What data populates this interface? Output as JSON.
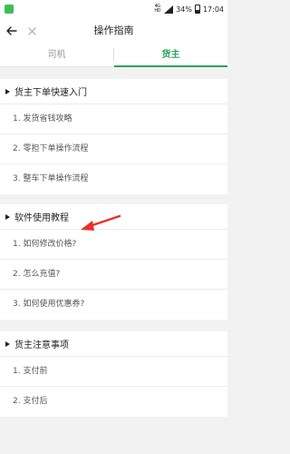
{
  "status_bar": {
    "network_top": "4G",
    "network_bottom": "HD",
    "battery": "34%",
    "time": "17:04",
    "app_icon_color": "#3fbf57"
  },
  "nav": {
    "title": "操作指南",
    "back_icon": "arrow-left-icon",
    "close_icon": "close-icon"
  },
  "tabs": [
    {
      "label": "司机",
      "active": false
    },
    {
      "label": "货主",
      "active": true
    }
  ],
  "accent_color": "#2aa35e",
  "annotation_color": "#e8312a",
  "sections": [
    {
      "title": "货主下单快速入门",
      "items": [
        "1. 发货省钱攻略",
        "2. 零担下单操作流程",
        "3. 整车下单操作流程"
      ]
    },
    {
      "title": "软件使用教程",
      "items": [
        "1. 如何修改价格?",
        "2. 怎么充值?",
        "3. 如何使用优惠券?"
      ]
    },
    {
      "title": "货主注意事项",
      "items": [
        "1. 支付前",
        "2. 支付后"
      ]
    }
  ]
}
